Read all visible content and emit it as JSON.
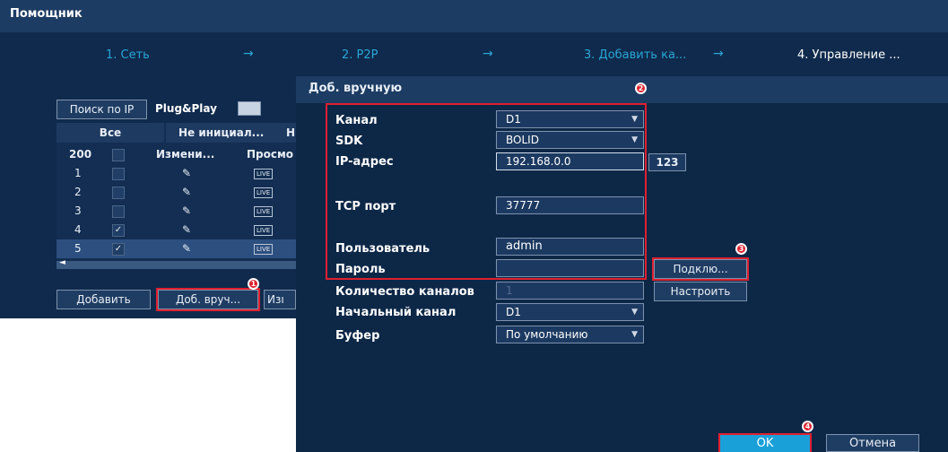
{
  "window": {
    "title": "Помощник"
  },
  "steps": [
    {
      "label": "1. Сеть"
    },
    {
      "label": "2. P2P"
    },
    {
      "label": "3. Добавить ка..."
    },
    {
      "label": "4. Управление ..."
    }
  ],
  "arrow_glyph": "→",
  "search": {
    "button": "Поиск по IP",
    "plugplay": "Plug&Play"
  },
  "filters": {
    "all": "Все",
    "uninit": "Не инициал...",
    "cut": "Н"
  },
  "table": {
    "count": "200",
    "col_edit": "Измени...",
    "col_view": "Просмо",
    "live_badge": "LIVE",
    "edit_glyph": "✎",
    "check_glyph": "✓",
    "rows": [
      {
        "num": "1"
      },
      {
        "num": "2"
      },
      {
        "num": "3"
      },
      {
        "num": "4"
      },
      {
        "num": "5"
      }
    ],
    "scroll_left": "◄"
  },
  "bottom": {
    "add": "Добавить",
    "manual": "Доб. вруч...",
    "cut": "Изı"
  },
  "dialog": {
    "title": "Доб. вручную",
    "channel_label": "Канал",
    "channel_value": "D1",
    "sdk_label": "SDK",
    "sdk_value": "BOLID",
    "ip_label": "IP-адрес",
    "ip_value": "192.168.0.0",
    "ip_mode": "123",
    "tcp_label": "TCP порт",
    "tcp_value": "37777",
    "user_label": "Пользователь",
    "user_value": "admin",
    "pass_label": "Пароль",
    "connect": "Подклю...",
    "count_label": "Количество каналов",
    "count_value": "1",
    "setup": "Настроить",
    "start_label": "Начальный канал",
    "start_value": "D1",
    "buffer_label": "Буфер",
    "buffer_value": "По умолчанию",
    "ok": "OK",
    "cancel": "Отмена"
  },
  "markers": [
    "1",
    "2",
    "3",
    "4"
  ],
  "colors": {
    "highlight": "#e0202e",
    "active_button": "#1aa0d8",
    "step_link": "#2aa6d6"
  }
}
